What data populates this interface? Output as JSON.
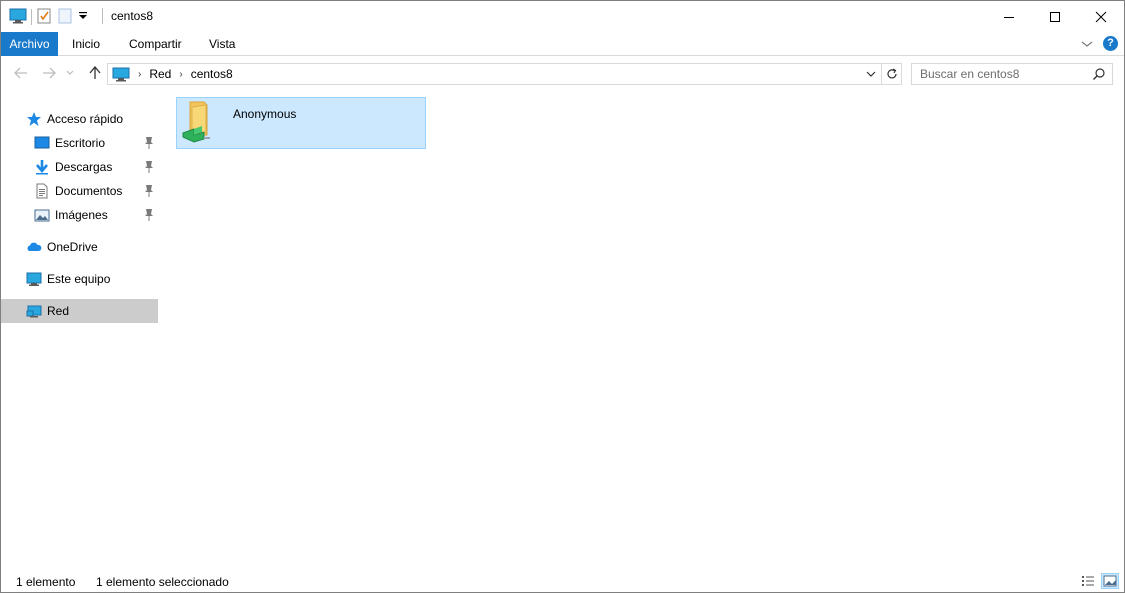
{
  "window": {
    "title": "centos8"
  },
  "ribbon": {
    "tabs": [
      "Archivo",
      "Inicio",
      "Compartir",
      "Vista"
    ],
    "help_label": "?"
  },
  "address": {
    "crumbs": [
      "Red",
      "centos8"
    ]
  },
  "search": {
    "placeholder": "Buscar en centos8"
  },
  "sidebar": {
    "items": [
      {
        "label": "Acceso rápido",
        "icon": "star-icon"
      },
      {
        "label": "Escritorio",
        "icon": "desktop-icon",
        "pinned": true
      },
      {
        "label": "Descargas",
        "icon": "download-icon",
        "pinned": true
      },
      {
        "label": "Documentos",
        "icon": "documents-icon",
        "pinned": true
      },
      {
        "label": "Imágenes",
        "icon": "pictures-icon",
        "pinned": true
      },
      {
        "label": "OneDrive",
        "icon": "cloud-icon"
      },
      {
        "label": "Este equipo",
        "icon": "computer-icon"
      },
      {
        "label": "Red",
        "icon": "network-icon",
        "selected": true
      }
    ]
  },
  "content": {
    "items": [
      {
        "name": "Anonymous",
        "icon": "shared-folder-icon",
        "selected": true
      }
    ]
  },
  "status": {
    "count": "1 elemento",
    "selection": "1 elemento seleccionado"
  },
  "colors": {
    "accent": "#1979ca",
    "selection_bg": "#cce8ff",
    "selection_border": "#99d1ff",
    "nav_selected_bg": "#cccccc"
  }
}
